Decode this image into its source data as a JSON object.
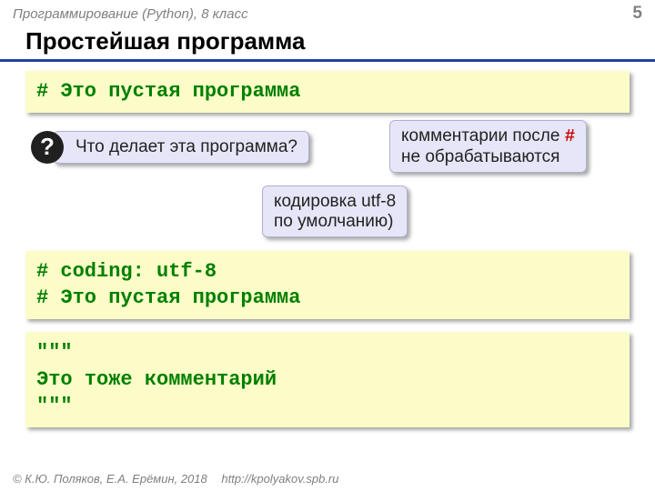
{
  "header": {
    "course": "Программирование (Python), 8 класс",
    "page": "5"
  },
  "title": "Простейшая программа",
  "code1": {
    "line1": "# Это пустая программа"
  },
  "question": {
    "mark": "?",
    "text": "Что делает эта программа?"
  },
  "note_hash": {
    "prefix": "комментарии после ",
    "hash": "#",
    "suffix": "не обрабатываются"
  },
  "note_utf": {
    "line1": "кодировка utf-8",
    "line2": "по умолчанию)"
  },
  "code2": {
    "line1": "# coding: utf-8",
    "line2": "# Это пустая программа"
  },
  "code3": {
    "line1": "\"\"\"",
    "line2": "Это тоже комментарий",
    "line3": "\"\"\""
  },
  "footer": {
    "copyright": "© К.Ю. Поляков, Е.А. Ерёмин, 2018",
    "url": "http://kpolyakov.spb.ru"
  }
}
